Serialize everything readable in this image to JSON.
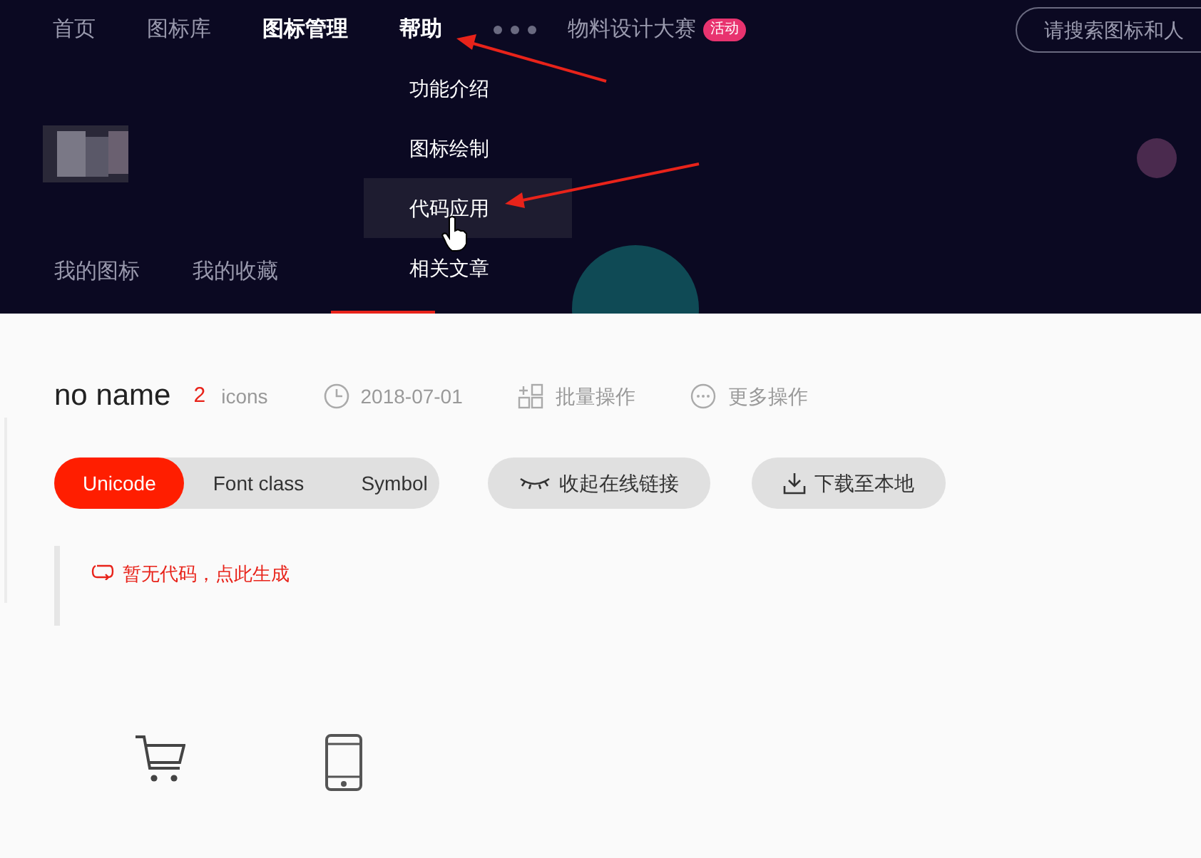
{
  "nav": {
    "items": [
      {
        "label": "首页",
        "active": false
      },
      {
        "label": "图标库",
        "active": false
      },
      {
        "label": "图标管理",
        "active": true
      },
      {
        "label": "帮助",
        "active": true
      }
    ],
    "event": {
      "label": "物料设计大赛",
      "badge": "活动"
    },
    "search": {
      "placeholder": "请搜索图标和人"
    }
  },
  "help_menu": {
    "items": [
      {
        "label": "功能介绍",
        "hovered": false
      },
      {
        "label": "图标绘制",
        "hovered": false
      },
      {
        "label": "代码应用",
        "hovered": true
      },
      {
        "label": "相关文章",
        "hovered": false
      }
    ]
  },
  "subtabs": [
    {
      "label": "我的图标",
      "selected": false
    },
    {
      "label": "我的收藏",
      "selected": false
    },
    {
      "selected": true
    }
  ],
  "project": {
    "name": "no name",
    "count": "2",
    "count_unit": "icons",
    "date": "2018-07-01",
    "actions": [
      {
        "kind": "batch",
        "label": "批量操作"
      },
      {
        "kind": "more",
        "label": "更多操作"
      }
    ]
  },
  "code_types": [
    {
      "label": "Unicode",
      "selected": true
    },
    {
      "label": "Font class",
      "selected": false
    },
    {
      "label": "Symbol",
      "selected": false
    }
  ],
  "buttons": [
    {
      "kind": "collapse",
      "label": "收起在线链接"
    },
    {
      "kind": "download",
      "label": "下载至本地"
    }
  ],
  "notice": "暂无代码，点此生成",
  "icon_grid": [
    {
      "kind": "cart"
    },
    {
      "kind": "phone"
    }
  ]
}
